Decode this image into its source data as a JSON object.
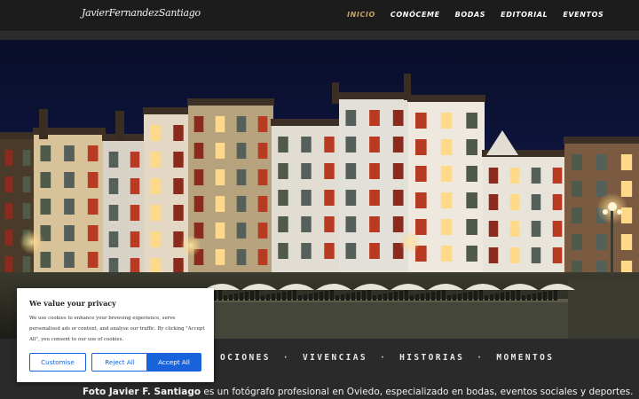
{
  "header": {
    "logo_text": "JavierFernandezSantiago",
    "nav": [
      {
        "label": "INICIO",
        "active": true
      },
      {
        "label": "CONÓCEME",
        "active": false
      },
      {
        "label": "BODAS",
        "active": false
      },
      {
        "label": "EDITORIAL",
        "active": false
      },
      {
        "label": "EVENTOS",
        "active": false
      }
    ],
    "active_color": "#c9a46a"
  },
  "tagline": {
    "items": [
      "EMOCIONES",
      "VIVENCIAS",
      "HISTORIAS",
      "MOMENTOS"
    ],
    "visible_first_fragment": "OCIONES",
    "separator": "·"
  },
  "intro": {
    "bold": "Foto Javier F. Santiago",
    "rest": " es un fotógrafo profesional en Oviedo, especializado en bodas, eventos sociales y deportes."
  },
  "cookie_banner": {
    "title": "We value your privacy",
    "body": "We use cookies to enhance your browsing experience, serve personalised ads or content, and analyse our traffic. By clicking \"Accept All\", you consent to our use of cookies.",
    "buttons": {
      "customise": "Customise",
      "reject": "Reject All",
      "accept": "Accept All"
    },
    "accent_color": "#1863dc"
  }
}
